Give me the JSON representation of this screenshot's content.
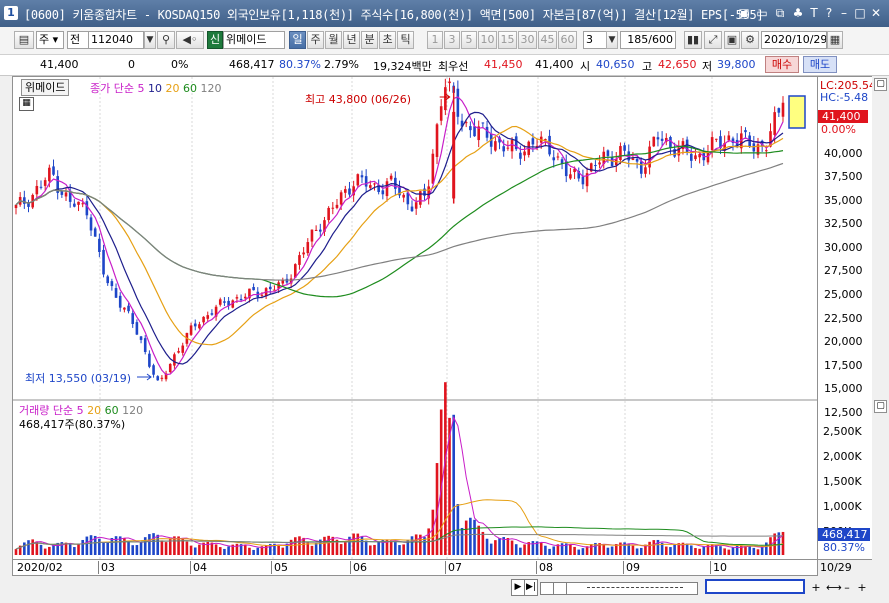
{
  "window": {
    "number": "1",
    "title": "[0600] 키움종합차트 - KOSDAQ150 외국인보유[1,118(천)] 주식수[16,800(천)] 액면[500] 자본금[87(억)] 결산[12월] EPS[-595]",
    "buttons": [
      "▣",
      "▭",
      "⧉",
      "♣",
      "T",
      "?",
      "–",
      "□",
      "✕"
    ]
  },
  "toolbar": {
    "period_label": "주",
    "prev_label": "전",
    "code_value": "112040",
    "credit_badge": "신",
    "stock_name": "위메이드",
    "period_tabs": [
      {
        "label": "일",
        "selected": true
      },
      {
        "label": "주",
        "selected": false
      },
      {
        "label": "월",
        "selected": false
      },
      {
        "label": "년",
        "selected": false
      },
      {
        "label": "분",
        "selected": false
      },
      {
        "label": "초",
        "selected": false
      },
      {
        "label": "틱",
        "selected": false
      }
    ],
    "interval_values": [
      "1",
      "3",
      "5",
      "10",
      "15",
      "30",
      "45",
      "60"
    ],
    "custom_interval": "3",
    "count_display": "185/600",
    "date_value": "2020/10/29"
  },
  "quote": {
    "price": "41,400",
    "change": "0",
    "change_pct": "0%",
    "volume": "468,417",
    "volume_ratio": "80.37%",
    "turnover_pct": "2.79%",
    "amount": "19,324백만",
    "best_bid_label": "최우선",
    "best_bid": "41,450",
    "best_ask": "41,400",
    "open_label": "시",
    "open": "40,650",
    "high_label": "고",
    "high": "42,650",
    "low_label": "저",
    "low": "39,800",
    "buy_label": "매수",
    "sell_label": "매도"
  },
  "price_panel": {
    "stock_tag": "위메이드",
    "legend_prefix": "종가 단순",
    "ma_periods": [
      "5",
      "10",
      "20",
      "60",
      "120"
    ],
    "max_annotation": "최고 43,800 (06/26)",
    "min_annotation": "최저 13,550 (03/19)",
    "lc_label": "LC:205.54",
    "hc_label": "HC:-5.48",
    "current_price_tag": "41,400",
    "current_pct_tag": "0.00%",
    "y_ticks": [
      "40,000",
      "37,500",
      "35,000",
      "32,500",
      "30,000",
      "27,500",
      "25,000",
      "22,500",
      "20,000",
      "17,500",
      "15,000",
      "12,500"
    ]
  },
  "volume_panel": {
    "title": "거래량 단순",
    "ma_periods": [
      "5",
      "20",
      "60",
      "120"
    ],
    "current_text": "468,417주(80.37%)",
    "y_ticks": [
      "2,500K",
      "2,000K",
      "1,500K",
      "1,000K",
      "500K"
    ],
    "volume_tag": "468,417",
    "volume_pct_tag": "80.37%"
  },
  "x_axis": {
    "labels": [
      "2020/02",
      "03",
      "04",
      "05",
      "06",
      "07",
      "08",
      "09",
      "10",
      "10/29"
    ]
  },
  "colors": {
    "up": "#e0141e",
    "down": "#1e46c8",
    "ma5": "#c81ec8",
    "ma10": "#1e1e8c",
    "ma20": "#e6a014",
    "ma60": "#1e8c1e",
    "ma120": "#808080"
  },
  "chart_data": {
    "type": "candlestick",
    "period": "daily",
    "x_range": [
      "2020/02",
      "2020/10/29"
    ],
    "price_range": [
      12500,
      41000
    ],
    "volume_range": [
      0,
      2500000
    ],
    "series": [
      {
        "name": "종가",
        "points": [
          [
            "2020/02",
            31000
          ],
          [
            "2020/02",
            32500
          ],
          [
            "2020/02",
            34500
          ],
          [
            "2020/02",
            31500
          ],
          [
            "2020/03",
            31000
          ],
          [
            "2020/03",
            24000
          ],
          [
            "2020/03",
            21500
          ],
          [
            "2020/03",
            18000
          ],
          [
            "2020/03",
            13550
          ],
          [
            "2020/03",
            17000
          ],
          [
            "2020/04",
            19500
          ],
          [
            "2020/04",
            21000
          ],
          [
            "2020/04",
            22000
          ],
          [
            "2020/04",
            22500
          ],
          [
            "2020/04",
            23000
          ],
          [
            "2020/05",
            23500
          ],
          [
            "2020/05",
            26500
          ],
          [
            "2020/05",
            29500
          ],
          [
            "2020/05",
            31500
          ],
          [
            "2020/05",
            34000
          ],
          [
            "2020/06",
            33000
          ],
          [
            "2020/06",
            33500
          ],
          [
            "2020/06",
            31500
          ],
          [
            "2020/06",
            32000
          ],
          [
            "2020/06",
            43800
          ],
          [
            "2020/07",
            39500
          ],
          [
            "2020/07",
            38500
          ],
          [
            "2020/07",
            37500
          ],
          [
            "2020/07",
            36500
          ],
          [
            "2020/07",
            37500
          ],
          [
            "2020/08",
            37000
          ],
          [
            "2020/08",
            34000
          ],
          [
            "2020/08",
            34500
          ],
          [
            "2020/08",
            36000
          ],
          [
            "2020/08",
            36500
          ],
          [
            "2020/09",
            35000
          ],
          [
            "2020/09",
            38000
          ],
          [
            "2020/09",
            37000
          ],
          [
            "2020/09",
            36000
          ],
          [
            "2020/10",
            37000
          ],
          [
            "2020/10",
            38000
          ],
          [
            "2020/10",
            37500
          ],
          [
            "2020/10",
            37000
          ],
          [
            "2020/10/29",
            41400
          ]
        ]
      },
      {
        "name": "거래량",
        "values": [
          200000,
          250000,
          180000,
          220000,
          300000,
          350000,
          280000,
          260000,
          400000,
          300000,
          220000,
          200000,
          180000,
          170000,
          150000,
          250000,
          300000,
          280000,
          320000,
          350000,
          260000,
          240000,
          300000,
          350000,
          2850000,
          800000,
          450000,
          300000,
          250000,
          220000,
          200000,
          180000,
          160000,
          220000,
          200000,
          180000,
          250000,
          200000,
          180000,
          170000,
          160000,
          150000,
          200000,
          468417
        ]
      }
    ]
  }
}
